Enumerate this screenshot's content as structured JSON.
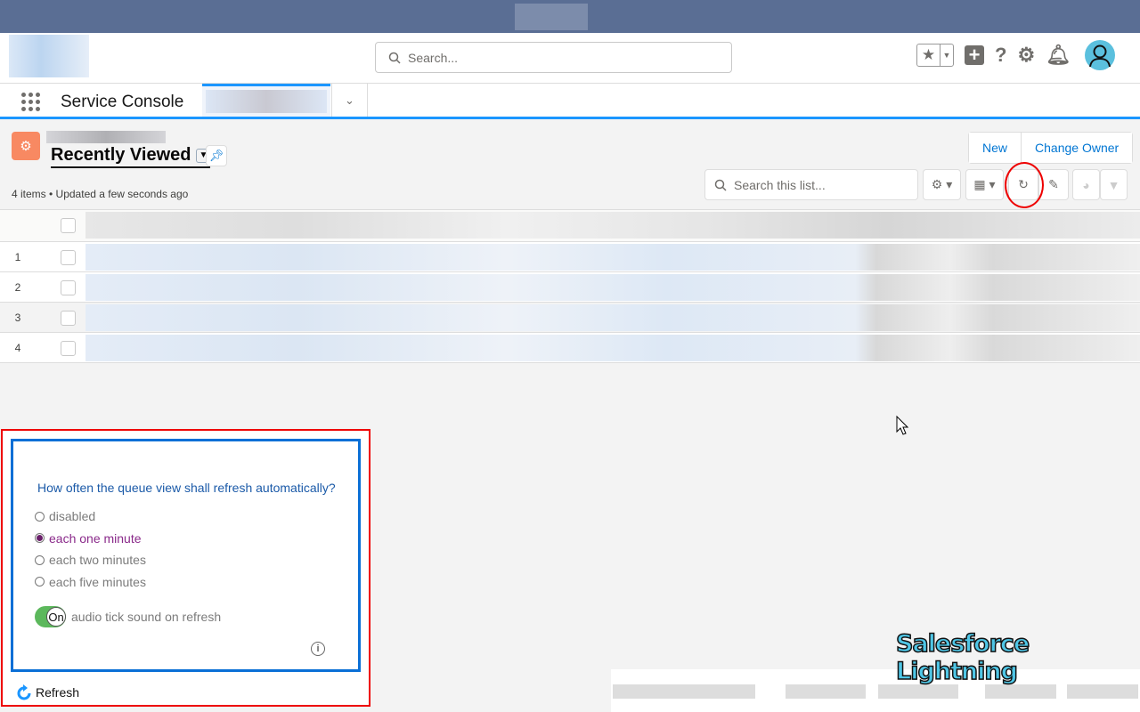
{
  "header": {
    "search_placeholder": "Search..."
  },
  "nav": {
    "app_name": "Service Console"
  },
  "list": {
    "title": "Recently Viewed",
    "meta": "4 items • Updated a few seconds ago",
    "buttons": {
      "new": "New",
      "change_owner": "Change Owner"
    },
    "search_placeholder": "Search this list...",
    "rows": [
      "1",
      "2",
      "3",
      "4"
    ]
  },
  "refresh_panel": {
    "question": "How often the queue view shall refresh automatically?",
    "options": [
      "disabled",
      "each one minute",
      "each two minutes",
      "each five minutes"
    ],
    "selected": "each one minute",
    "toggle_state": "On",
    "toggle_label": "audio tick sound on refresh",
    "footer_label": "Refresh"
  },
  "brand_text": "Salesforce Lightning",
  "colors": {
    "accent": "#0176d3",
    "highlight": "#e00000",
    "panel_border": "#0a6fd6",
    "toggle": "#5cb85c"
  }
}
